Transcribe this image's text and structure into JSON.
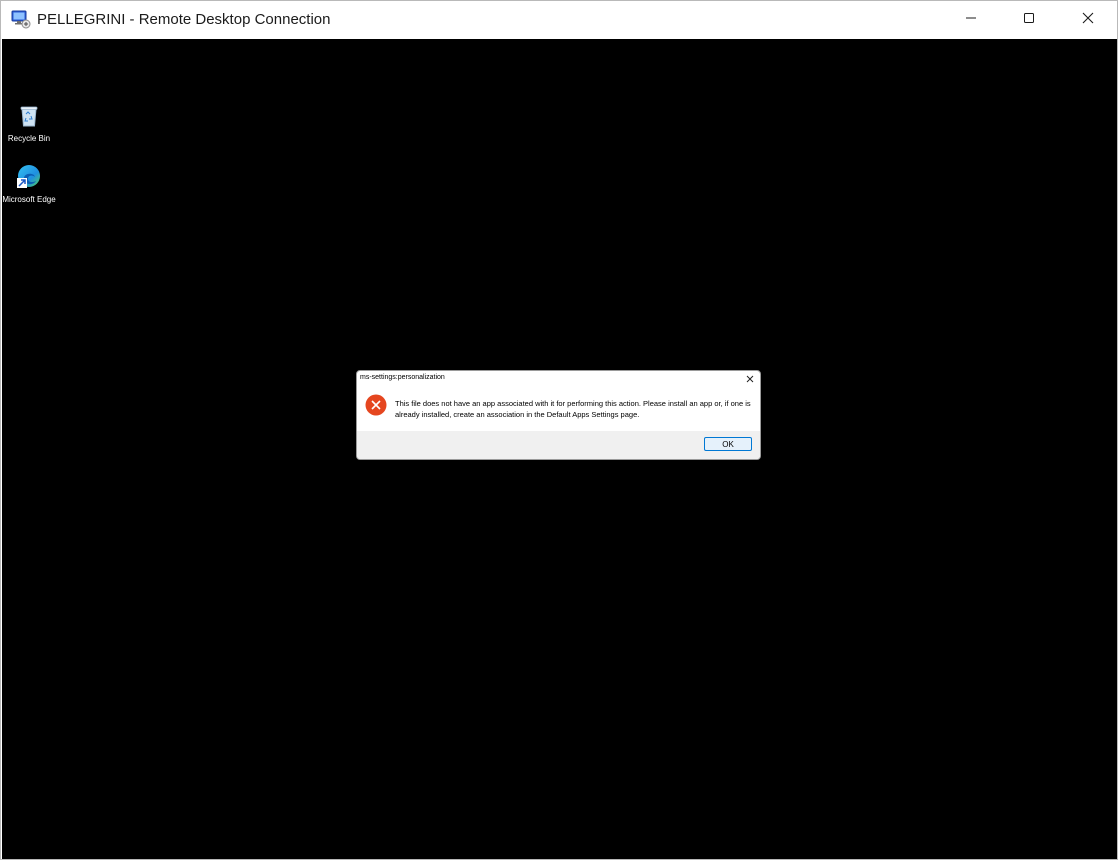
{
  "window": {
    "title": "PELLEGRINI - Remote Desktop Connection",
    "icon": "remote-desktop-icon",
    "controls": {
      "minimize": "minimize-icon",
      "maximize": "maximize-icon",
      "close": "close-icon"
    }
  },
  "desktop": {
    "background": "#000000",
    "icons": [
      {
        "label": "Recycle Bin",
        "icon": "recycle-bin-icon"
      },
      {
        "label": "Microsoft Edge",
        "icon": "edge-icon"
      }
    ]
  },
  "dialog": {
    "title": "ms-settings:personalization",
    "icon": "error-icon",
    "error_color": "#e5461f",
    "message": "This file does not have an app associated with it for performing this action. Please install an app or, if one is already installed, create an association in the Default Apps Settings page.",
    "ok_label": "OK"
  }
}
